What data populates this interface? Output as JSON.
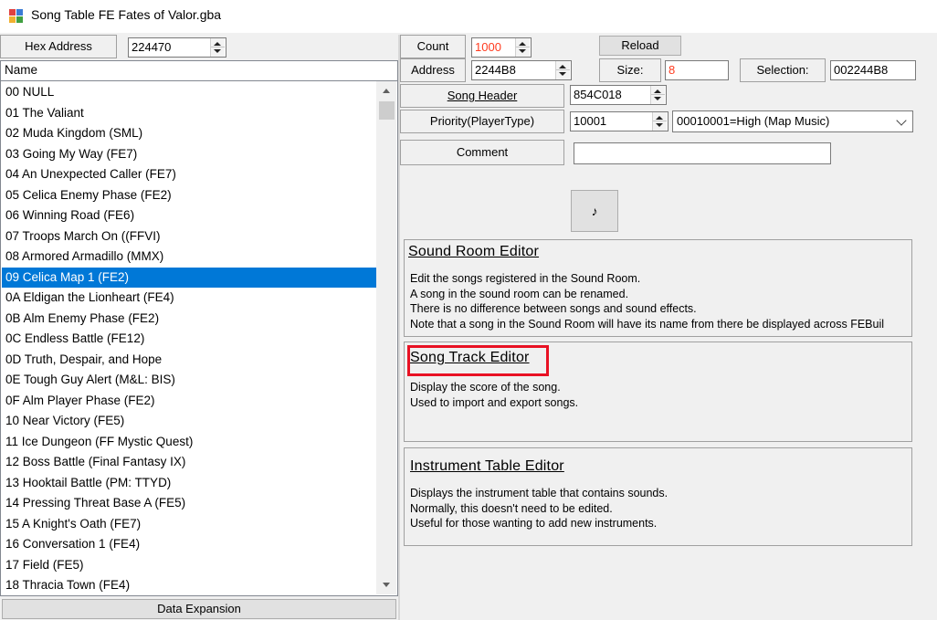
{
  "window": {
    "title": "Song Table FE Fates of Valor.gba"
  },
  "left": {
    "hex_address_label": "Hex Address",
    "hex_address_value": "224470",
    "name_header": "Name",
    "items": [
      "00 NULL",
      "01 The Valiant",
      "02 Muda Kingdom (SML)",
      "03 Going My Way (FE7)",
      "04 An Unexpected Caller (FE7)",
      "05 Celica Enemy Phase (FE2)",
      "06 Winning Road (FE6)",
      "07 Troops March On ((FFVI)",
      "08 Armored Armadillo (MMX)",
      "09 Celica Map 1 (FE2)",
      "0A Eldigan the Lionheart (FE4)",
      "0B Alm Enemy Phase (FE2)",
      "0C Endless Battle (FE12)",
      "0D Truth, Despair, and Hope",
      "0E Tough Guy Alert (M&L: BIS)",
      "0F Alm Player Phase (FE2)",
      "10 Near Victory (FE5)",
      "11 Ice Dungeon (FF Mystic Quest)",
      "12 Boss Battle (Final Fantasy IX)",
      "13 Hooktail Battle (PM: TTYD)",
      "14 Pressing Threat Base A (FE5)",
      "15 A Knight's Oath (FE7)",
      "16 Conversation 1 (FE4)",
      "17 Field (FE5)",
      "18 Thracia Town (FE4)"
    ],
    "selected_index": 9,
    "data_expansion_label": "Data Expansion"
  },
  "top": {
    "count_label": "Count",
    "count_value": "1000",
    "reload_label": "Reload",
    "address_label": "Address",
    "address_value": "2244B8",
    "size_label": "Size:",
    "size_value": "8",
    "selection_label": "Selection:",
    "selection_value": "002244B8"
  },
  "form": {
    "song_header_label": "Song Header",
    "song_header_value": "854C018",
    "priority_label": "Priority(PlayerType)",
    "priority_value": "10001",
    "priority_select": "00010001=High (Map Music)",
    "comment_label": "Comment",
    "comment_value": "",
    "play_button_glyph": "♪"
  },
  "panels": {
    "sound_room": {
      "title": "Sound Room Editor",
      "lines": [
        "Edit the songs registered in the Sound Room.",
        "A song in the sound room can be renamed.",
        "There is no difference between songs and sound effects.",
        "Note that a song in the Sound Room will have its name from there be displayed across FEBuil"
      ]
    },
    "song_track": {
      "title": "Song Track Editor",
      "lines": [
        "Display the score of the song.",
        "Used to import and export songs."
      ]
    },
    "instrument_table": {
      "title": "Instrument Table Editor",
      "lines": [
        "Displays the instrument table that contains sounds.",
        "Normally, this doesn't need to be edited.",
        "Useful for those wanting to add new instruments."
      ]
    }
  },
  "colors": {
    "selection": "#0078d7",
    "highlight_border": "#e81123",
    "red_value": "#ff3b1f"
  }
}
